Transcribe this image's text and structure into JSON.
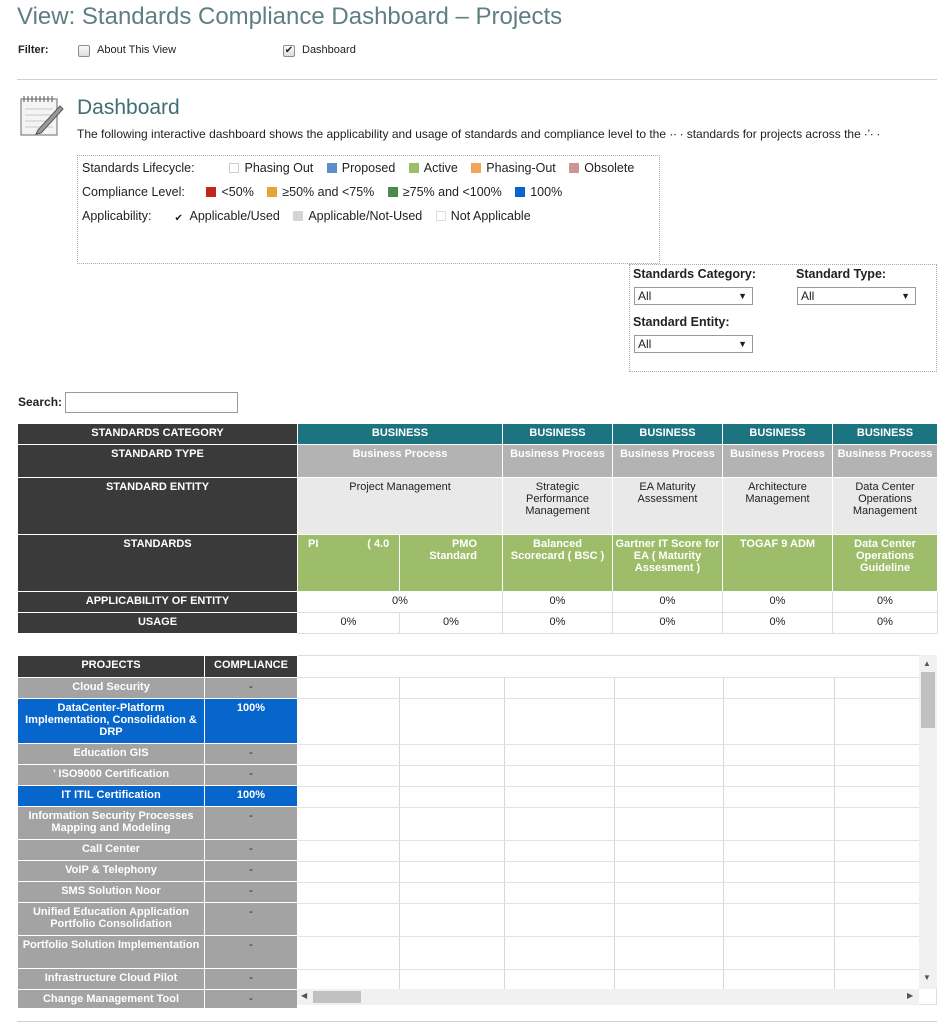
{
  "page": {
    "title": "View: Standards Compliance Dashboard – Projects"
  },
  "filter": {
    "label": "Filter:",
    "options": [
      {
        "label": "About This View",
        "checked": false
      },
      {
        "label": "Dashboard",
        "checked": true
      }
    ]
  },
  "dashboard": {
    "heading": "Dashboard",
    "description": "The following interactive dashboard shows the applicability and usage of standards and compliance level to the ·∙ ∙ standards for projects across the ∙’∙ ∙"
  },
  "legend": {
    "lifecycle": {
      "label": "Standards Lifecycle:",
      "items": [
        {
          "label": "Phasing Out",
          "color": "#ffffff"
        },
        {
          "label": "Proposed",
          "color": "#5b8ec9"
        },
        {
          "label": "Active",
          "color": "#9dbd6a"
        },
        {
          "label": "Phasing-Out",
          "color": "#f2a55a"
        },
        {
          "label": "Obsolete",
          "color": "#cc9494"
        }
      ]
    },
    "compliance": {
      "label": "Compliance Level:",
      "items": [
        {
          "label": "<50%",
          "color": "#c0271a"
        },
        {
          "label": "≥50% and <75%",
          "color": "#e4a532"
        },
        {
          "label": "≥75% and <100%",
          "color": "#4a8a4e"
        },
        {
          "label": "100%",
          "color": "#0766cc"
        }
      ]
    },
    "applicability": {
      "label": "Applicability:",
      "items": [
        {
          "label": "Applicable/Used",
          "color": "#ffffff",
          "checked": true
        },
        {
          "label": "Applicable/Not-Used",
          "color": "#d4d4d4"
        },
        {
          "label": "Not Applicable",
          "color": "#ffffff"
        }
      ]
    }
  },
  "filters": {
    "category": {
      "label": "Standards Category:",
      "value": "All"
    },
    "type": {
      "label": "Standard Type:",
      "value": "All"
    },
    "entity": {
      "label": "Standard Entity:",
      "value": "All"
    }
  },
  "search": {
    "label": "Search:",
    "value": ""
  },
  "matrix": {
    "row_headers": {
      "category": "STANDARDS CATEGORY",
      "type": "STANDARD TYPE",
      "entity": "STANDARD ENTITY",
      "standards": "STANDARDS",
      "applicability": "APPLICABILITY OF ENTITY",
      "usage": "USAGE"
    },
    "groups": [
      {
        "category": "BUSINESS",
        "type": "Business Process",
        "entity": "Project Management",
        "applicability": "0%",
        "standards": [
          {
            "name": "PI                ( 4.0",
            "usage": "0%"
          },
          {
            "name": "PMO Standard",
            "usage": "0%"
          }
        ]
      },
      {
        "category": "BUSINESS",
        "type": "Business Process",
        "entity": "Strategic Performance Management",
        "applicability": "0%",
        "standards": [
          {
            "name": "Balanced Scorecard ( BSC )",
            "usage": "0%"
          }
        ]
      },
      {
        "category": "BUSINESS",
        "type": "Business Process",
        "entity": "EA Maturity Assessment",
        "applicability": "0%",
        "standards": [
          {
            "name": "Gartner IT Score for EA ( Maturity Assesment )",
            "usage": "0%"
          }
        ]
      },
      {
        "category": "BUSINESS",
        "type": "Business Process",
        "entity": "Architecture Management",
        "applicability": "0%",
        "standards": [
          {
            "name": "TOGAF 9 ADM",
            "usage": "0%"
          }
        ]
      },
      {
        "category": "BUSINESS",
        "type": "Business Process",
        "entity": "Data Center Operations Management",
        "applicability": "0%",
        "standards": [
          {
            "name": "Data Center Operations Guideline",
            "usage": "0%"
          }
        ]
      }
    ]
  },
  "projects": {
    "headers": {
      "project": "PROJECTS",
      "compliance": "COMPLIANCE"
    },
    "rows": [
      {
        "name": "Cloud Security",
        "compliance": "-",
        "status": "none"
      },
      {
        "name": "DataCenter-Platform Implementation, Consolidation & DRP",
        "compliance": "100%",
        "status": "full"
      },
      {
        "name": "Education GIS",
        "compliance": "-",
        "status": "none"
      },
      {
        "name": "’ ISO9000 Certification",
        "compliance": "-",
        "status": "none"
      },
      {
        "name": "IT ITIL Certification",
        "compliance": "100%",
        "status": "full"
      },
      {
        "name": "Information Security Processes Mapping and Modeling",
        "compliance": "-",
        "status": "none"
      },
      {
        "name": "Call Center",
        "compliance": "-",
        "status": "none"
      },
      {
        "name": "VoIP & Telephony",
        "compliance": "-",
        "status": "none"
      },
      {
        "name": "SMS Solution Noor",
        "compliance": "-",
        "status": "none"
      },
      {
        "name": "Unified Education Application Portfolio Consolidation",
        "compliance": "-",
        "status": "none"
      },
      {
        "name": "Portfolio Solution Implementation",
        "compliance": "-",
        "status": "none"
      },
      {
        "name": "Infrastructure Cloud Pilot",
        "compliance": "-",
        "status": "none"
      },
      {
        "name": "Change Management Tool",
        "compliance": "-",
        "status": "none"
      }
    ]
  },
  "icons": {
    "dashboard": "notepad-pencil-icon",
    "scroll_up": "arrow-up-icon",
    "scroll_down": "arrow-down-icon",
    "scroll_left": "arrow-left-icon",
    "scroll_right": "arrow-right-icon"
  }
}
